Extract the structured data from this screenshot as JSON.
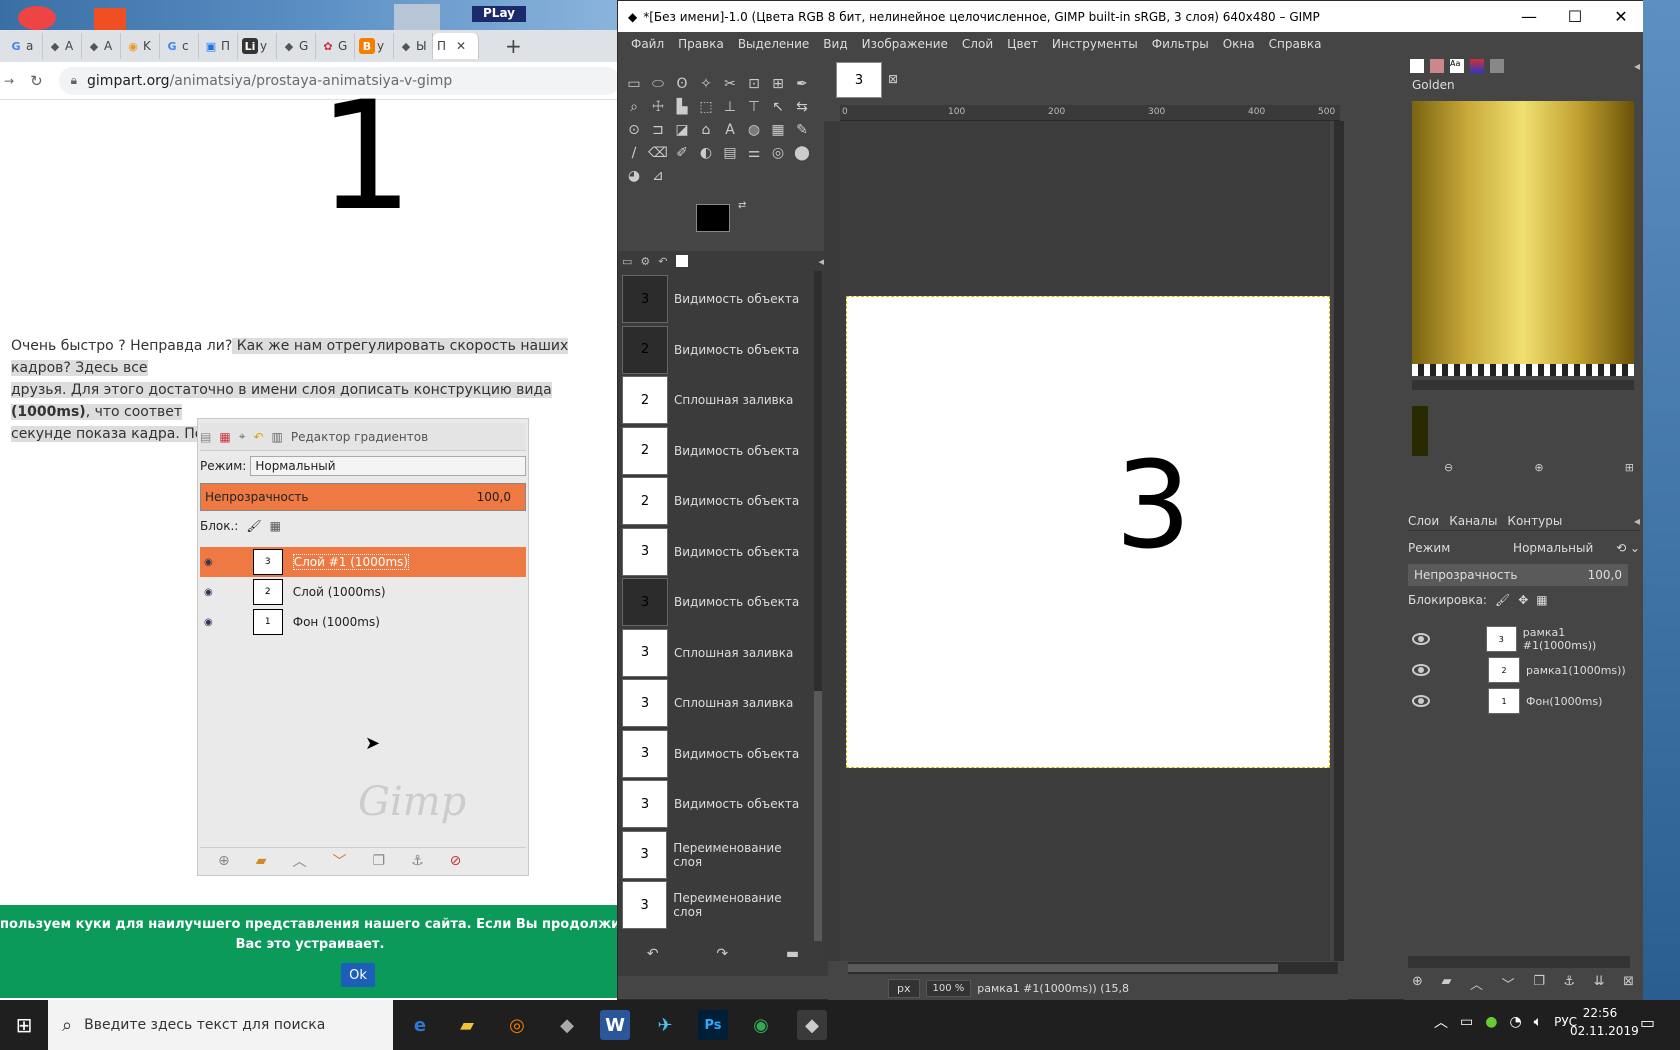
{
  "browser": {
    "tabs": [
      "a",
      "A",
      "A",
      "K",
      "c",
      "П",
      "y",
      "G",
      "G",
      "y",
      "Ы",
      "П"
    ],
    "new_tab": "+",
    "url_host": "gimpart.org",
    "url_path": "/animatsiya/prostaya-animatsiya-v-gimp",
    "big_number": "1",
    "paragraph": {
      "start": "Очень быстро ? Неправда ли?",
      "highlighted_1": " Как же нам отрегулировать скорость наших кадров? Здесь все",
      "highlighted_2": "друзья. Для этого достаточно в имени слоя дописать конструкцию вида ",
      "bold": "(1000ms)",
      "highlighted_3": ", что соответ",
      "highlighted_4": "секунде показа кадра. Посмотрите, что у меня получилось"
    },
    "screenshot": {
      "tab_gradient_editor": "Редактор градиентов",
      "mode_label": "Режим:",
      "mode_value": "Нормальный",
      "opacity_label": "Непрозрачность",
      "opacity_value": "100,0",
      "lock_label": "Блок.:",
      "layers": [
        {
          "thumb": "3",
          "name": "Слой #1 (1000ms)"
        },
        {
          "thumb": "2",
          "name": "Слой (1000ms)"
        },
        {
          "thumb": "1",
          "name": "Фон (1000ms)"
        }
      ],
      "watermark": "Gimp"
    },
    "cookie_line1": "пользуем куки для наилучшего представления нашего сайта. Если Вы продолжите использовать сайт,",
    "cookie_line2": "Вас это устраивает.",
    "cookie_ok": "Ok"
  },
  "desktop_top": {
    "play_label": "PLay"
  },
  "gimp": {
    "title": "*[Без имени]-1.0 (Цвета RGB 8 бит, нелинейное целочисленное, GIMP built-in sRGB, 3 слоя) 640x480 – GIMP",
    "menu": [
      "Файл",
      "Правка",
      "Выделение",
      "Вид",
      "Изображение",
      "Слой",
      "Цвет",
      "Инструменты",
      "Фильтры",
      "Окна",
      "Справка"
    ],
    "history": [
      {
        "thumb": "3",
        "label": "Видимость объекта",
        "dark": true
      },
      {
        "thumb": "2",
        "label": "Видимость объекта",
        "dark": true
      },
      {
        "thumb": "2",
        "label": "Сплошная заливка",
        "dark": false
      },
      {
        "thumb": "2",
        "label": "Видимость объекта",
        "dark": false
      },
      {
        "thumb": "2",
        "label": "Видимость объекта",
        "dark": false
      },
      {
        "thumb": "3",
        "label": "Видимость объекта",
        "dark": false
      },
      {
        "thumb": "3",
        "label": "Видимость объекта",
        "dark": true
      },
      {
        "thumb": "3",
        "label": "Сплошная заливка",
        "dark": false
      },
      {
        "thumb": "3",
        "label": "Сплошная заливка",
        "dark": false
      },
      {
        "thumb": "3",
        "label": "Видимость объекта",
        "dark": false
      },
      {
        "thumb": "3",
        "label": "Видимость объекта",
        "dark": false
      },
      {
        "thumb": "3",
        "label": "Переименование слоя",
        "dark": false
      },
      {
        "thumb": "3",
        "label": "Переименование слоя",
        "dark": false
      }
    ],
    "image_tab": "3",
    "ruler_ticks": [
      "0",
      "100",
      "200",
      "300",
      "400",
      "500"
    ],
    "canvas_number": "3",
    "status": {
      "unit": "px",
      "zoom": "100 %",
      "info": "рамка1 #1(1000ms)) (15,8"
    },
    "gradient_name": "Golden",
    "layers_tabs": [
      "Слои",
      "Каналы",
      "Контуры"
    ],
    "mode_label": "Режим",
    "mode_value": "Нормальный",
    "opacity_label": "Непрозрачность",
    "opacity_value": "100,0",
    "lock_label": "Блокировка:",
    "layers": [
      {
        "thumb": "3",
        "name": "рамка1 #1(1000ms))"
      },
      {
        "thumb": "2",
        "name": "рамка1(1000ms))"
      },
      {
        "thumb": "1",
        "name": "Фон(1000ms)"
      }
    ]
  },
  "taskbar": {
    "search_placeholder": "Введите здесь текст для поиска",
    "lang": "РУС",
    "time": "22:56",
    "date": "02.11.2019"
  }
}
